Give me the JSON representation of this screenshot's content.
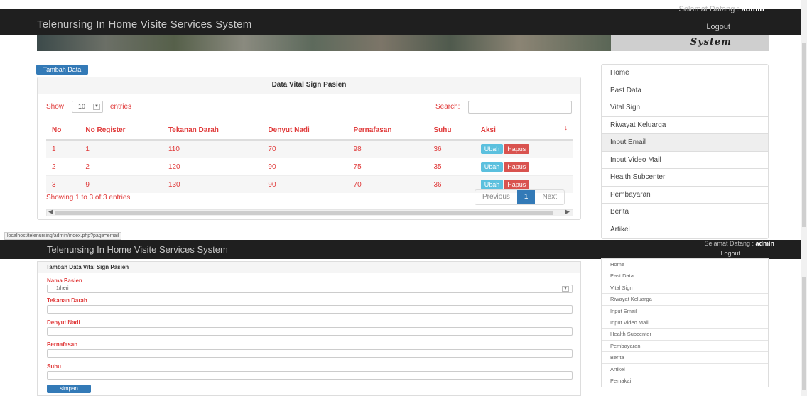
{
  "top": {
    "navbar": {
      "brand": "Telenursing In Home Visite Services System",
      "greeting": "Selamat Datang : ",
      "user": "admin",
      "logout": "Logout"
    },
    "banner_text": "System",
    "add_button": "Tambah Data",
    "panel_title": "Data Vital Sign Pasien",
    "table_controls": {
      "show": "Show",
      "entries_value": "10",
      "entries": "entries",
      "search": "Search:"
    },
    "table": {
      "headers": [
        "No",
        "No Register",
        "Tekanan Darah",
        "Denyut Nadi",
        "Pernafasan",
        "Suhu",
        "Aksi"
      ],
      "rows": [
        [
          "1",
          "1",
          "110",
          "70",
          "98",
          "36"
        ],
        [
          "2",
          "2",
          "120",
          "90",
          "75",
          "35"
        ],
        [
          "3",
          "9",
          "130",
          "90",
          "70",
          "36"
        ]
      ],
      "edit_label": "Ubah",
      "delete_label": "Hapus"
    },
    "info": "Showing 1 to 3 of 3 entries",
    "pager": {
      "previous": "Previous",
      "current": "1",
      "next": "Next"
    },
    "status_url": "localhost/telenursing/admin/index.php?page=email",
    "sidebar": [
      "Home",
      "Past Data",
      "Vital Sign",
      "Riwayat Keluarga",
      "Input Email",
      "Input Video Mail",
      "Health Subcenter",
      "Pembayaran",
      "Berita",
      "Artikel"
    ],
    "active_sidebar_index": 4
  },
  "bottom": {
    "navbar": {
      "brand": "Telenursing In Home Visite Services System",
      "greeting": "Selamat Datang : ",
      "user": "admin",
      "logout": "Logout"
    },
    "panel_title": "Tambah Data Vital Sign Pasien",
    "form": {
      "nama_pasien_label": "Nama Pasien",
      "nama_pasien_value": "1/heri",
      "tekanan_darah_label": "Tekanan Darah",
      "denyut_nadi_label": "Denyut Nadi",
      "pernafasan_label": "Pernafasan",
      "suhu_label": "Suhu",
      "submit": "simpan"
    },
    "sidebar": [
      "Home",
      "Past Data",
      "Vital Sign",
      "Riwayat Keluarga",
      "Input Email",
      "Input Video Mail",
      "Health Subcenter",
      "Pembayaran",
      "Berita",
      "Artikel",
      "Pemakai"
    ]
  }
}
